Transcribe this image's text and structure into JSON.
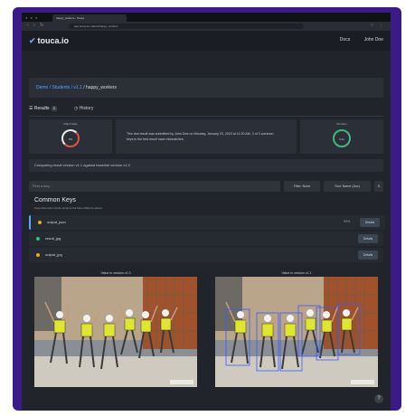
{
  "browser": {
    "tab_title": "happy_workers - Touca",
    "url": "app.touca.io/~/demo/happy_workers"
  },
  "app": {
    "logo": "touca.io",
    "nav": {
      "docs": "Docs",
      "user": "John Doe"
    },
    "breadcrumb": {
      "team_suite": "Demo / Students / v1.1",
      "testcase": "/ happy_workers"
    },
    "tabs": {
      "results": "Results",
      "results_count": "3",
      "history": "History"
    },
    "cards": {
      "match_caption": "Match Rate",
      "match_value": "0%",
      "submission_text": "This test result was submitted by John Doe on Monday, January 23, 2023 at 11:20 AM. 3 of 3 common keys in the test result have mismatches.",
      "duration_caption": "Duration",
      "duration_value": "0.4s"
    },
    "compare_text": "Comparing result version v1.1 against baseline version v1.0",
    "filter": {
      "placeholder": "Find a key...",
      "type_label": "Filter: None",
      "sort_label": "Sort: Name (Asc)",
      "order_icon": "sort-icon"
    },
    "section": {
      "title": "Common Keys",
      "subtitle": "Keys that exist in both versions but have different values."
    },
    "rows": [
      {
        "name": "output_json",
        "meta": "99%",
        "action": "Details",
        "color": "#f0a33a"
      },
      {
        "name": "result_jpg",
        "meta": "",
        "action": "Details",
        "color": "#3fb97a"
      },
      {
        "name": "output_jpg",
        "meta": "",
        "action": "Details",
        "color": "#f0a33a"
      }
    ],
    "images": {
      "left_label": "Value in version v1.0",
      "right_label": "Value in version v1.1"
    },
    "colors": {
      "accent": "#5aa7ff",
      "warning": "#f0a33a",
      "success": "#3fb97a",
      "match_ring": "#e9edf2",
      "match_ring_arc": "#e0523f"
    }
  }
}
